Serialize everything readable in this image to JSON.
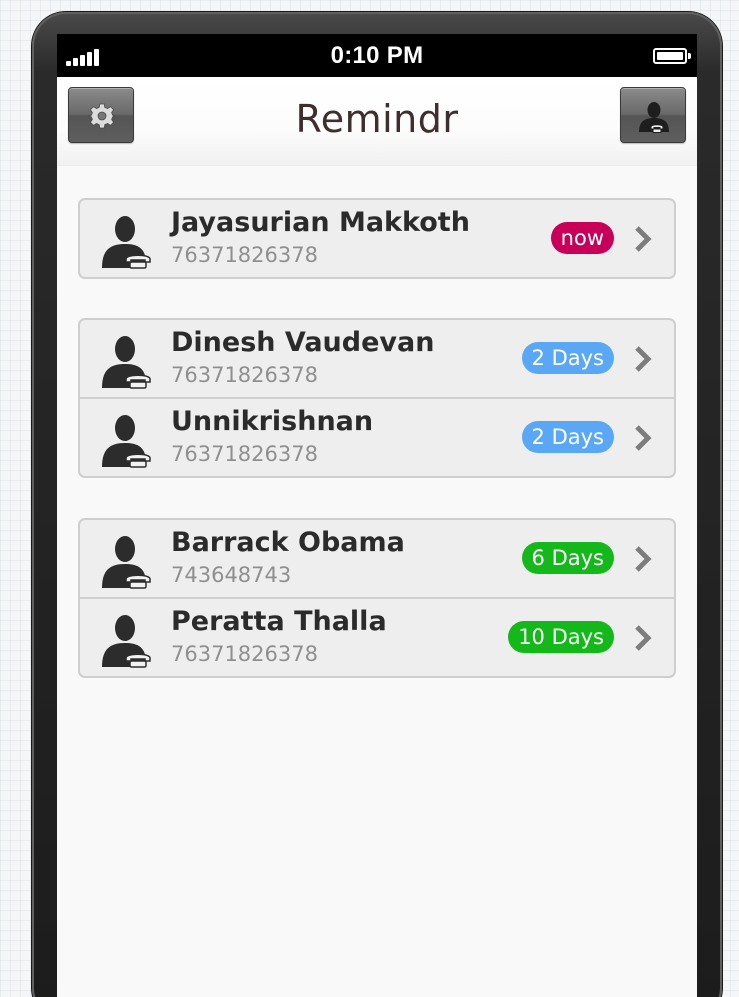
{
  "status_bar": {
    "time": "0:10 PM",
    "signal_icon": "signal-bars-icon",
    "battery_icon": "battery-icon"
  },
  "nav": {
    "title": "Remindr",
    "left_button_icon": "gear-icon",
    "right_button_icon": "contact-phone-icon"
  },
  "colors": {
    "now": "#c9005a",
    "soon": "#5aa8f5",
    "later": "#15b81a"
  },
  "groups": [
    {
      "rows": [
        {
          "name": "Jayasurian Makkoth",
          "phone": "76371826378",
          "badge": "now",
          "badge_color": "#c9005a"
        }
      ]
    },
    {
      "rows": [
        {
          "name": "Dinesh Vaudevan",
          "phone": "76371826378",
          "badge": "2 Days",
          "badge_color": "#5aa8f5"
        },
        {
          "name": "Unnikrishnan",
          "phone": "76371826378",
          "badge": "2 Days",
          "badge_color": "#5aa8f5"
        }
      ]
    },
    {
      "rows": [
        {
          "name": "Barrack Obama",
          "phone": "743648743",
          "badge": "6 Days",
          "badge_color": "#15b81a"
        },
        {
          "name": "Peratta Thalla",
          "phone": "76371826378",
          "badge": "10 Days",
          "badge_color": "#15b81a"
        }
      ]
    }
  ]
}
